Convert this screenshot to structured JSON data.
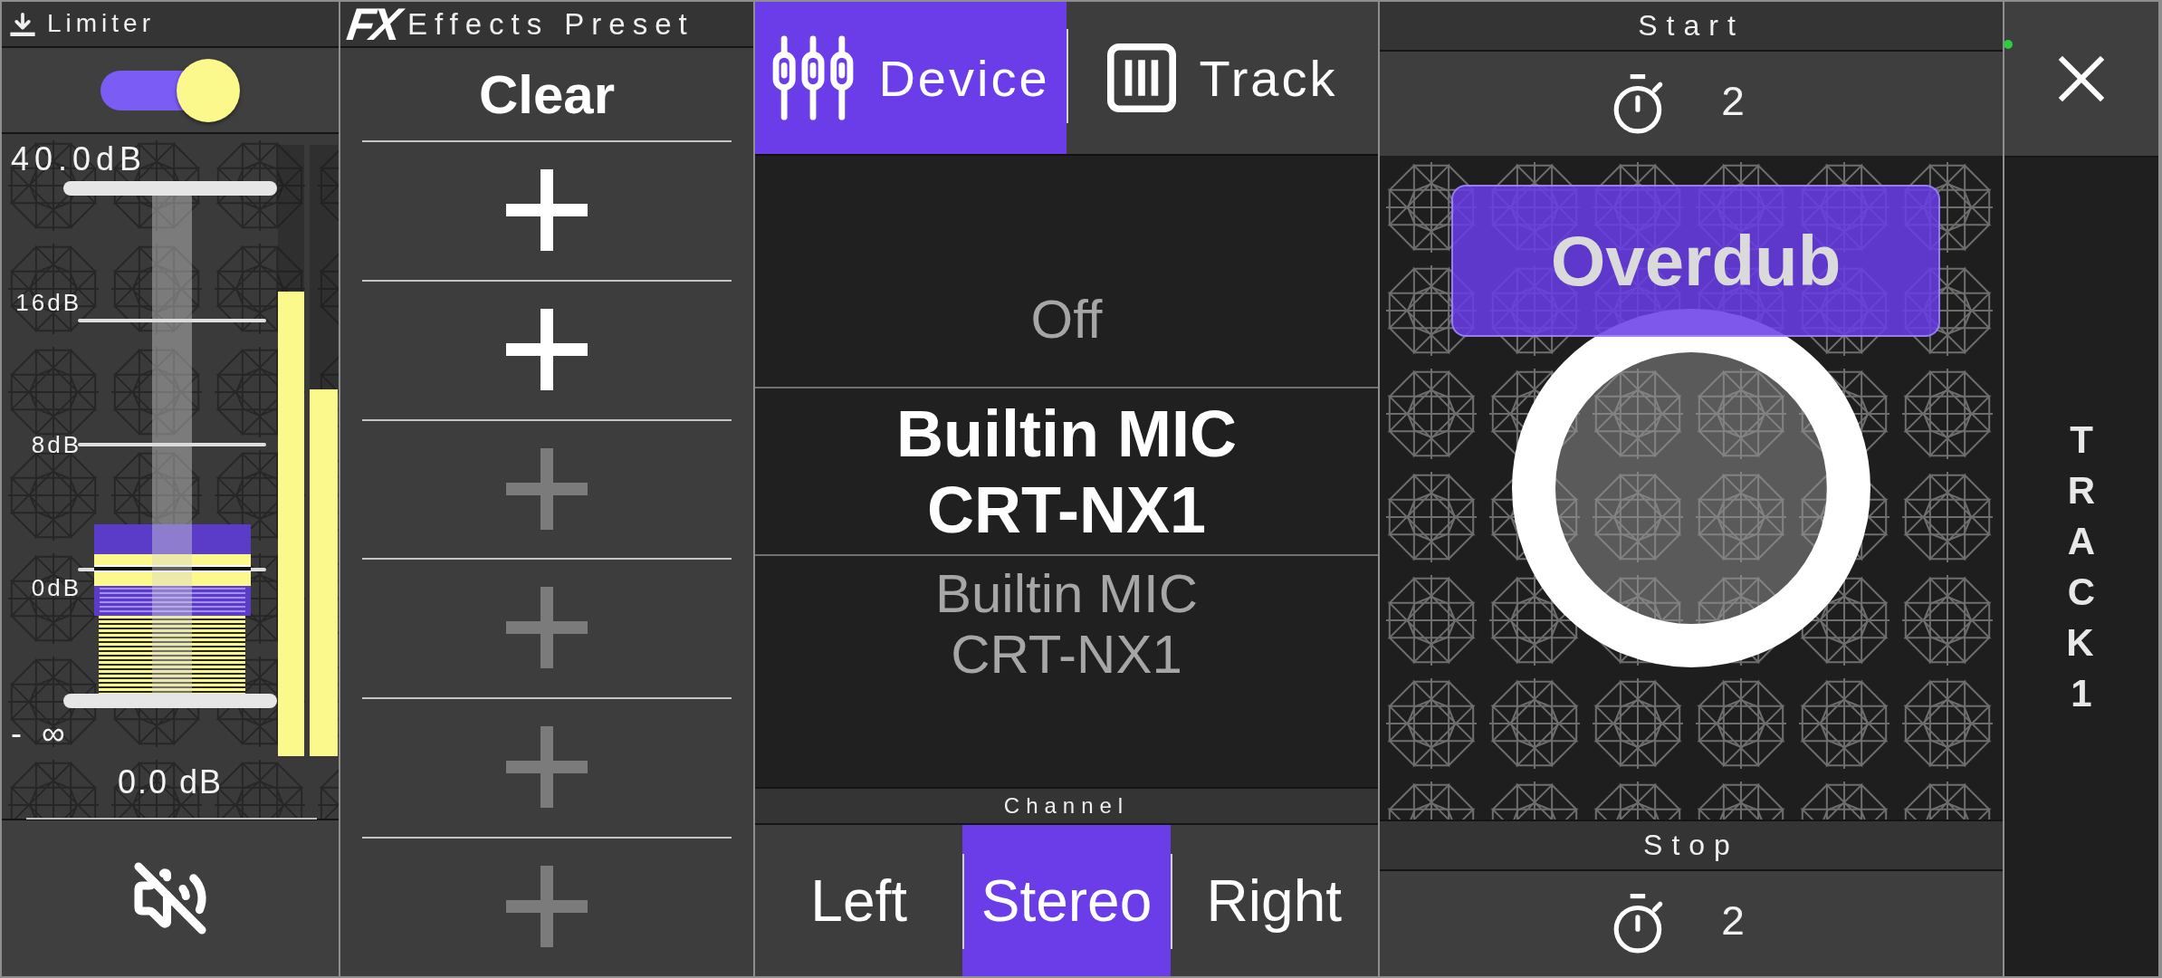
{
  "limiter": {
    "title": "Limiter",
    "on": true
  },
  "fader": {
    "scale": [
      "40.0dB",
      "16dB",
      "8dB",
      "0dB",
      "- ∞"
    ],
    "level": 0.25,
    "reading": "0.0 dB"
  },
  "meters": [
    {
      "level": 0.76
    },
    {
      "level": 0.6
    }
  ],
  "effects": {
    "logo": "FX",
    "title": "Effects Preset",
    "clear": "Clear",
    "slots": [
      {
        "disabled": false
      },
      {
        "disabled": false
      },
      {
        "disabled": true
      },
      {
        "disabled": true
      },
      {
        "disabled": true
      },
      {
        "disabled": true
      }
    ]
  },
  "source_tabs": [
    {
      "kind": "device",
      "label": "Device",
      "selected": true
    },
    {
      "kind": "track",
      "label": "Track",
      "selected": false
    }
  ],
  "input_picker": [
    {
      "label": "Off",
      "selected": false
    },
    {
      "label": "Builtin MIC CRT-NX1",
      "selected": true
    },
    {
      "label": "Builtin MIC CRT-NX1",
      "selected": false
    }
  ],
  "channel": {
    "title": "Channel",
    "options": [
      {
        "label": "Left",
        "selected": false
      },
      {
        "label": "Stereo",
        "selected": true
      },
      {
        "label": "Right",
        "selected": false
      }
    ]
  },
  "start": {
    "title": "Start",
    "count": "2"
  },
  "overdub": {
    "label": "Overdub"
  },
  "stop": {
    "title": "Stop",
    "count": "2"
  },
  "track_label": "TRACK 1"
}
